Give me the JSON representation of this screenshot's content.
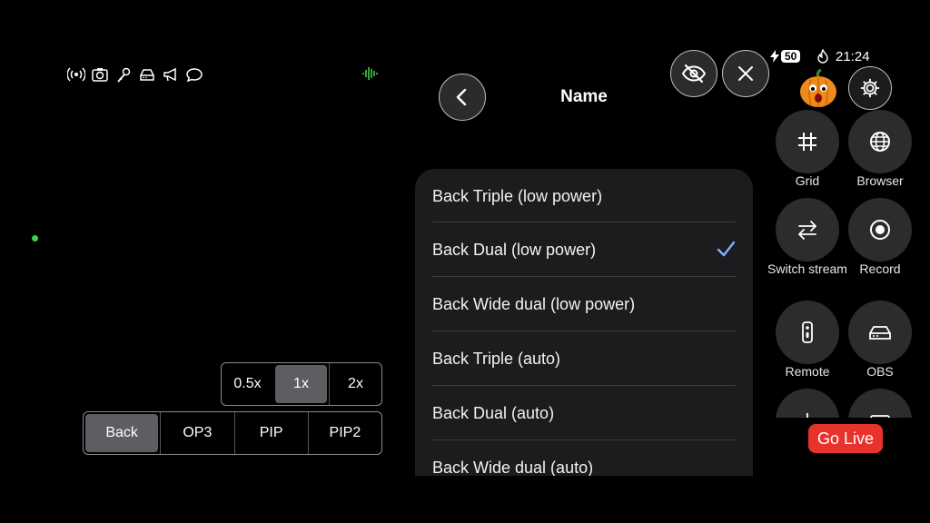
{
  "status_bar": {
    "battery": "50",
    "time": "21:24"
  },
  "picker": {
    "title": "Name",
    "items": [
      {
        "label": "Back Triple (low power)",
        "selected": false
      },
      {
        "label": "Back Dual (low power)",
        "selected": true
      },
      {
        "label": "Back Wide dual (low power)",
        "selected": false
      },
      {
        "label": "Back Triple (auto)",
        "selected": false
      },
      {
        "label": "Back Dual (auto)",
        "selected": false
      },
      {
        "label": "Back Wide dual (auto)",
        "selected": false
      }
    ]
  },
  "zoom": {
    "options": [
      "0.5x",
      "1x",
      "2x"
    ],
    "selected": "1x"
  },
  "cameras": {
    "options": [
      "Back",
      "OP3",
      "PIP",
      "PIP2"
    ],
    "selected": "Back"
  },
  "quick_buttons": {
    "grid": "Grid",
    "browser": "Browser",
    "switch_stream": "Switch stream",
    "record": "Record",
    "remote": "Remote",
    "obs": "OBS"
  },
  "go_live": "Go Live",
  "colors": {
    "accent_check": "#7fb0ff",
    "go_live": "#e8332d",
    "audio_indicator": "#3ecf4a"
  },
  "icons": [
    "signal-icon",
    "camera-icon",
    "microphone-icon",
    "obs-icon",
    "megaphone-icon",
    "chat-icon"
  ]
}
